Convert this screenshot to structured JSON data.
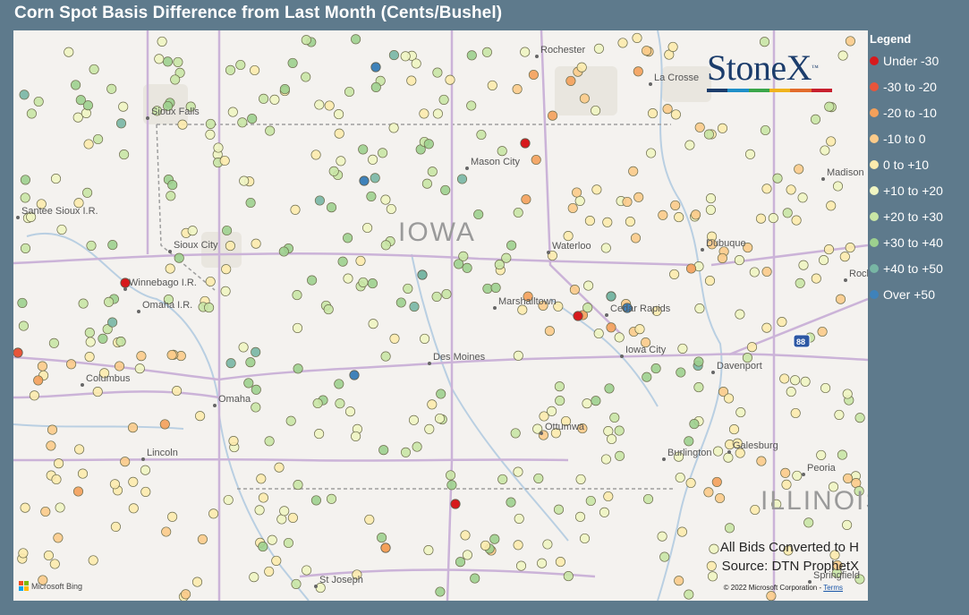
{
  "title": "Corn Spot Basis Difference from Last Month (Cents/Bushel)",
  "legend": {
    "title": "Legend",
    "items": [
      {
        "label": "Under -30",
        "color": "#d7191c"
      },
      {
        "label": "-30 to -20",
        "color": "#e8553a"
      },
      {
        "label": "-20 to -10",
        "color": "#f4a05a"
      },
      {
        "label": "-10 to 0",
        "color": "#fccb8a"
      },
      {
        "label": "0 to +10",
        "color": "#fdebad"
      },
      {
        "label": "+10 to +20",
        "color": "#f0f5c2"
      },
      {
        "label": "+20 to +30",
        "color": "#c9e6a5"
      },
      {
        "label": "+30 to +40",
        "color": "#9dd08e"
      },
      {
        "label": "+40 to +50",
        "color": "#78b6a4"
      },
      {
        "label": "Over +50",
        "color": "#3f82ba"
      }
    ]
  },
  "logo": {
    "text": "StoneX",
    "tm": "™",
    "bar_colors": [
      "#1c3d6c",
      "#1f8fc8",
      "#3aa64a",
      "#f0b31c",
      "#e26b2b",
      "#c8202e"
    ]
  },
  "map": {
    "state_labels": [
      "IOWA",
      "ILLINOIS"
    ],
    "cities": [
      "Rochester",
      "La Crosse",
      "Sioux Falls",
      "Mason City",
      "Madison",
      "Santee Sioux I.R.",
      "Sioux City",
      "Waterloo",
      "Dubuque",
      "Winnebago I.R.",
      "Omaha I.R.",
      "Marshalltown",
      "Cedar Rapids",
      "Iowa City",
      "Columbus",
      "Omaha",
      "Des Moines",
      "Davenport",
      "Ottumwa",
      "Galesburg",
      "Peoria",
      "Lincoln",
      "Burlington",
      "St Joseph",
      "Springfield",
      "Rockford"
    ],
    "interstate_shield": "88"
  },
  "source_note": {
    "line1": "All Bids Converted to H",
    "line2": "Source: DTN ProphetX"
  },
  "attribution": {
    "bing": "Microsoft Bing",
    "copyright": "© 2022 Microsoft Corporation",
    "terms": "Terms"
  }
}
